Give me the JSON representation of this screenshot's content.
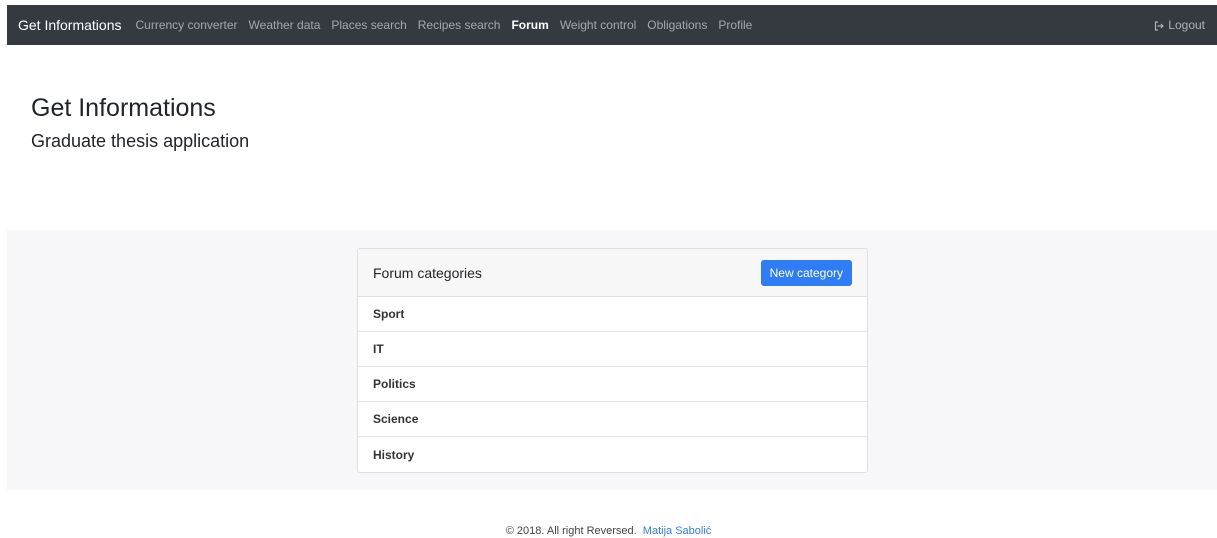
{
  "navbar": {
    "brand": "Get Informations",
    "links": [
      {
        "label": "Currency converter",
        "active": false
      },
      {
        "label": "Weather data",
        "active": false
      },
      {
        "label": "Places search",
        "active": false
      },
      {
        "label": "Recipes search",
        "active": false
      },
      {
        "label": "Forum",
        "active": true
      },
      {
        "label": "Weight control",
        "active": false
      },
      {
        "label": "Obligations",
        "active": false
      },
      {
        "label": "Profile",
        "active": false
      }
    ],
    "logout_label": "Logout",
    "logout_icon": "sign-out-icon"
  },
  "hero": {
    "title": "Get Informations",
    "subtitle": "Graduate thesis application"
  },
  "forum": {
    "header_title": "Forum categories",
    "new_category_label": "New category",
    "categories": [
      "Sport",
      "IT",
      "Politics",
      "Science",
      "History"
    ]
  },
  "footer": {
    "text": "© 2018. All right Reversed.",
    "author": "Matija Sabolić"
  },
  "colors": {
    "navbar_bg": "#343a40",
    "primary": "#2f7df6",
    "band_bg": "#f7f7f9"
  }
}
